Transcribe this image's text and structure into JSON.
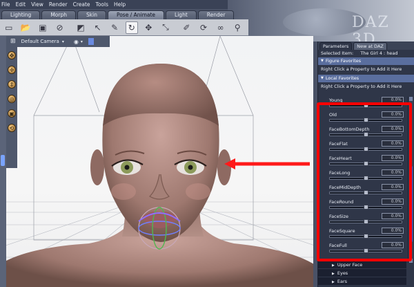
{
  "menu": [
    "File",
    "Edit",
    "View",
    "Render",
    "Create",
    "Tools",
    "Help"
  ],
  "brand_text": "DAZ 3D",
  "rooms": [
    {
      "label": "Lighting",
      "active": false
    },
    {
      "label": "Morph",
      "active": false
    },
    {
      "label": "Skin",
      "active": false
    },
    {
      "label": "Pose / Animate",
      "active": true
    },
    {
      "label": "Light",
      "active": false
    },
    {
      "label": "Render",
      "active": false
    }
  ],
  "toolbar_icons": [
    "new-file-icon",
    "open-file-icon",
    "save-icon",
    "undo-icon",
    "scene-icon",
    "select-icon",
    "universal-tool-icon",
    "rotate-icon",
    "translate-icon",
    "scale-icon",
    "active-pose-icon",
    "twist-icon",
    "chain-icon",
    "node-icon"
  ],
  "viewport": {
    "camera": "Default Camera"
  },
  "panel": {
    "tabs": [
      "Parameters",
      "New at DAZ"
    ],
    "selected_label": "Selected Item:",
    "selected_value": "The Girl 4 : head",
    "figure_favorites": {
      "title": "Figure Favorites",
      "hint": "Right Click a Property to Add it Here"
    },
    "local_favorites": {
      "title": "Local Favorites",
      "hint": "Right Click a Property to Add it Here"
    },
    "sliders": [
      {
        "name": "Young",
        "value": "0.0%"
      },
      {
        "name": "Old",
        "value": "0.0%"
      },
      {
        "name": "FaceBottomDepth",
        "value": "0.0%"
      },
      {
        "name": "FaceFlat",
        "value": "0.0%"
      },
      {
        "name": "FaceHeart",
        "value": "0.0%"
      },
      {
        "name": "FaceLong",
        "value": "0.0%"
      },
      {
        "name": "FaceMidDepth",
        "value": "0.0%"
      },
      {
        "name": "FaceRound",
        "value": "0.0%"
      },
      {
        "name": "FaceSize",
        "value": "0.0%"
      },
      {
        "name": "FaceSquare",
        "value": "0.0%"
      },
      {
        "name": "FaceFull",
        "value": "0.0%"
      }
    ],
    "subgroups": [
      "Upper Face",
      "Eyes",
      "Ears"
    ]
  },
  "colors": {
    "highlight": "#ff0000",
    "panel_bg": "#2f3648",
    "group_header": "#5a6e9e"
  }
}
